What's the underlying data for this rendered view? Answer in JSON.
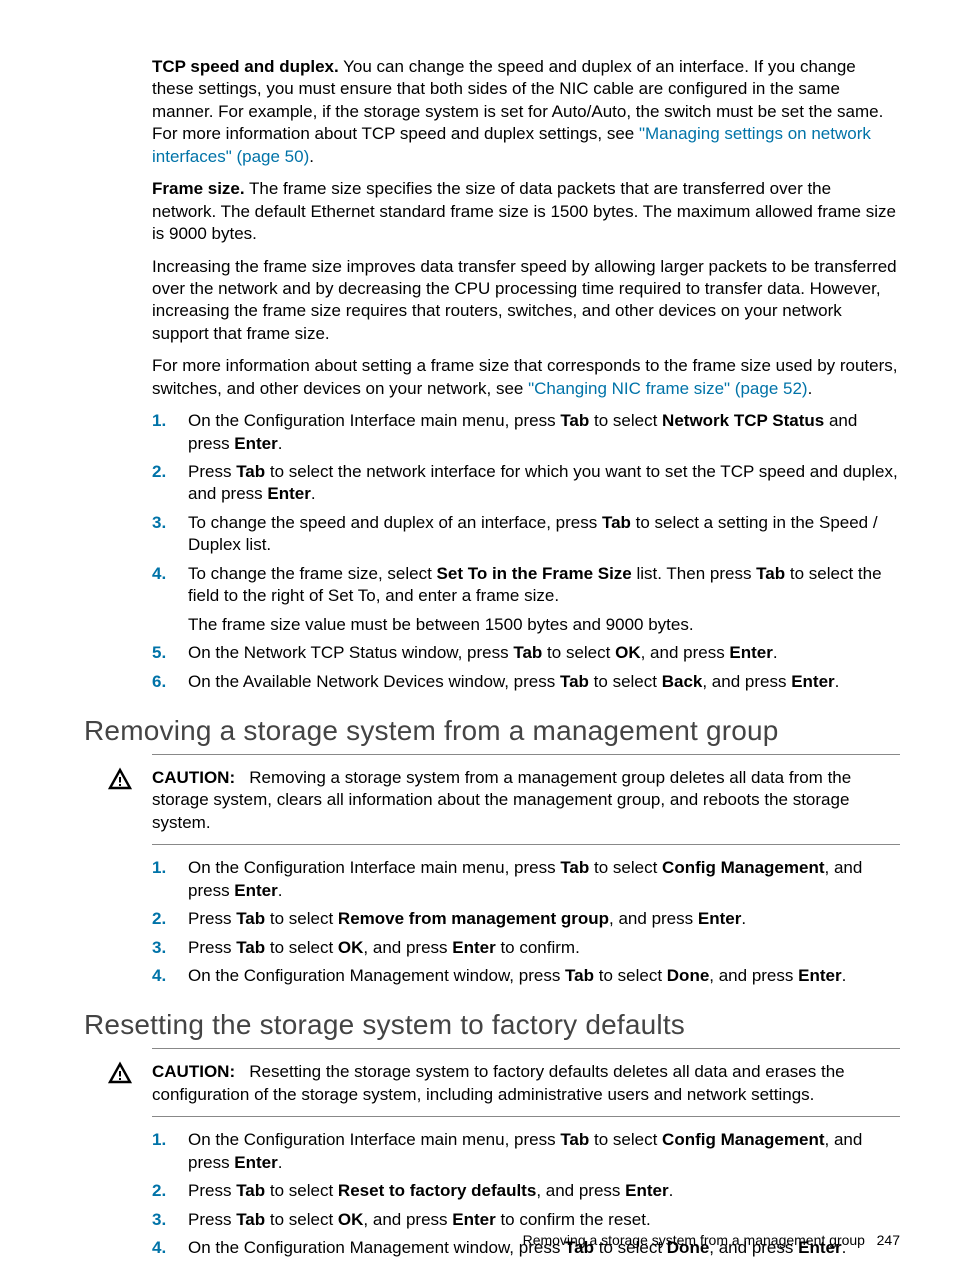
{
  "para1": {
    "bold": "TCP speed and duplex.",
    "text": " You can change the speed and duplex of an interface. If you change these settings, you must ensure that both sides of the NIC cable are configured in the same manner. For example, if the storage system is set for Auto/Auto, the switch must be set the same. For more information about TCP speed and duplex settings, see ",
    "link": "\"Managing settings on network interfaces\" (page 50)",
    "tail": "."
  },
  "para2": {
    "bold": "Frame size.",
    "text": " The frame size specifies the size of data packets that are transferred over the network. The default Ethernet standard frame size is 1500 bytes. The maximum allowed frame size is 9000 bytes."
  },
  "para3": "Increasing the frame size improves data transfer speed by allowing larger packets to be transferred over the network and by decreasing the CPU processing time required to transfer data. However, increasing the frame size requires that routers, switches, and other devices on your network support that frame size.",
  "para4": {
    "text": "For more information about setting a frame size that corresponds to the frame size used by routers, switches, and other devices on your network, see ",
    "link": "\"Changing NIC frame size\" (page 52)",
    "tail": "."
  },
  "steps1": [
    {
      "n": "1.",
      "pre": "On the Configuration Interface main menu, press ",
      "b1": "Tab",
      "mid": " to select ",
      "b2": "Network TCP Status",
      "mid2": " and press ",
      "b3": "Enter",
      "tail": "."
    },
    {
      "n": "2.",
      "pre": "Press ",
      "b1": "Tab",
      "mid": " to select the network interface for which you want to set the TCP speed and duplex, and press ",
      "b2": "Enter",
      "tail": "."
    },
    {
      "n": "3.",
      "pre": "To change the speed and duplex of an interface, press ",
      "b1": "Tab",
      "mid": " to select a setting in the Speed / Duplex list.",
      "tail": ""
    },
    {
      "n": "4.",
      "pre": "To change the frame size, select ",
      "b1": "Set To in the Frame Size",
      "mid": " list. Then press ",
      "b2": "Tab",
      "mid2": " to select the field to the right of Set To, and enter a frame size.",
      "sub": "The frame size value must be between 1500 bytes and 9000 bytes."
    },
    {
      "n": "5.",
      "pre": "On the Network TCP Status window, press ",
      "b1": "Tab",
      "mid": " to select ",
      "b2": "OK",
      "mid2": ", and press ",
      "b3": "Enter",
      "tail": "."
    },
    {
      "n": "6.",
      "pre": "On the Available Network Devices window, press ",
      "b1": "Tab",
      "mid": " to select ",
      "b2": "Back",
      "mid2": ", and press ",
      "b3": "Enter",
      "tail": "."
    }
  ],
  "h2_removing": "Removing a storage system from a management group",
  "caution1": {
    "label": "CAUTION:",
    "text": "Removing a storage system from a management group deletes all data from the storage system, clears all information about the management group, and reboots the storage system."
  },
  "steps2": [
    {
      "n": "1.",
      "pre": "On the Configuration Interface main menu, press ",
      "b1": "Tab",
      "mid": " to select ",
      "b2": "Config Management",
      "mid2": ", and press ",
      "b3": "Enter",
      "tail": "."
    },
    {
      "n": "2.",
      "pre": "Press ",
      "b1": "Tab",
      "mid": " to select ",
      "b2": "Remove from management group",
      "mid2": ", and press ",
      "b3": "Enter",
      "tail": "."
    },
    {
      "n": "3.",
      "pre": "Press ",
      "b1": "Tab",
      "mid": " to select ",
      "b2": "OK",
      "mid2": ", and press ",
      "b3": "Enter",
      "tail": " to confirm."
    },
    {
      "n": "4.",
      "pre": "On the Configuration Management window, press ",
      "b1": "Tab",
      "mid": " to select ",
      "b2": "Done",
      "mid2": ", and press ",
      "b3": "Enter",
      "tail": "."
    }
  ],
  "h2_resetting": "Resetting the storage system to factory defaults",
  "caution2": {
    "label": "CAUTION:",
    "text": "Resetting the storage system to factory defaults deletes all data and erases the configuration of the storage system, including administrative users and network settings."
  },
  "steps3": [
    {
      "n": "1.",
      "pre": "On the Configuration Interface main menu, press ",
      "b1": "Tab",
      "mid": " to select ",
      "b2": "Config Management",
      "mid2": ", and press ",
      "b3": "Enter",
      "tail": "."
    },
    {
      "n": "2.",
      "pre": "Press ",
      "b1": "Tab",
      "mid": " to select ",
      "b2": "Reset to factory defaults",
      "mid2": ", and press ",
      "b3": "Enter",
      "tail": "."
    },
    {
      "n": "3.",
      "pre": "Press ",
      "b1": "Tab",
      "mid": " to select ",
      "b2": "OK",
      "mid2": ", and press ",
      "b3": "Enter",
      "tail": " to confirm the reset."
    },
    {
      "n": "4.",
      "pre": "On the Configuration Management window, press ",
      "b1": "Tab",
      "mid": " to select ",
      "b2": "Done",
      "mid2": ", and press ",
      "b3": "Enter",
      "tail": "."
    }
  ],
  "footer": {
    "title": "Removing a storage system from a management group",
    "page": "247"
  }
}
